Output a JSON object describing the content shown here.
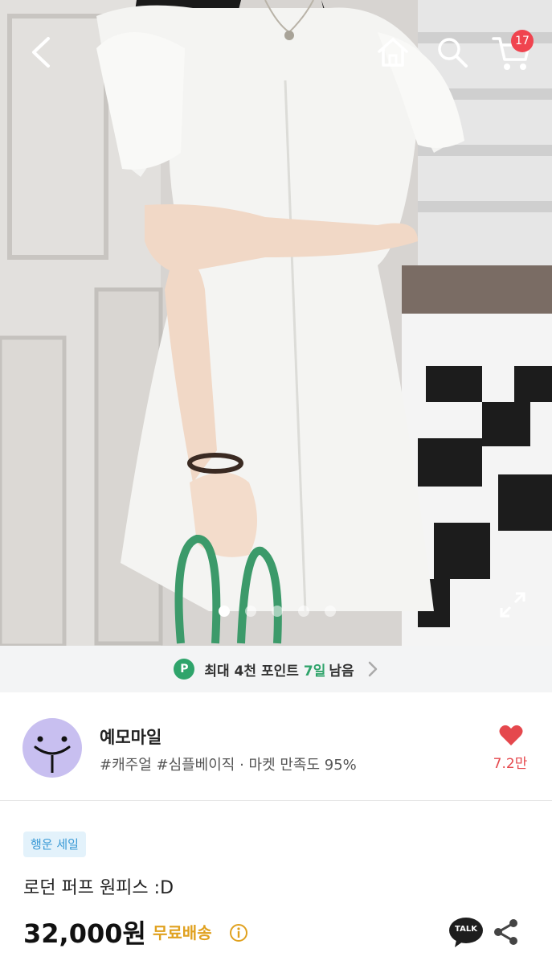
{
  "header": {
    "cart_count": "17",
    "icons": [
      "chevron-left-icon",
      "home-icon",
      "search-icon",
      "cart-icon"
    ]
  },
  "gallery": {
    "image_count": 5,
    "active_index": 0,
    "expand_icon": "expand-icon"
  },
  "points_banner": {
    "badge": "P",
    "text": "최대 4천 포인트",
    "days": "7일",
    "suffix": "남음",
    "accent_color": "#2fa46b"
  },
  "store": {
    "name": "예모마일",
    "meta": "#캐주얼 #심플베이직 · 마켓 만족도 95%",
    "likes": "7.2만",
    "like_color": "#e5484d"
  },
  "product": {
    "sale_tag": "행운 세일",
    "title": "로던 퍼프 원피스 :D",
    "price": "32,000원",
    "shipping": "무료배송",
    "talk_label": "TALK"
  }
}
